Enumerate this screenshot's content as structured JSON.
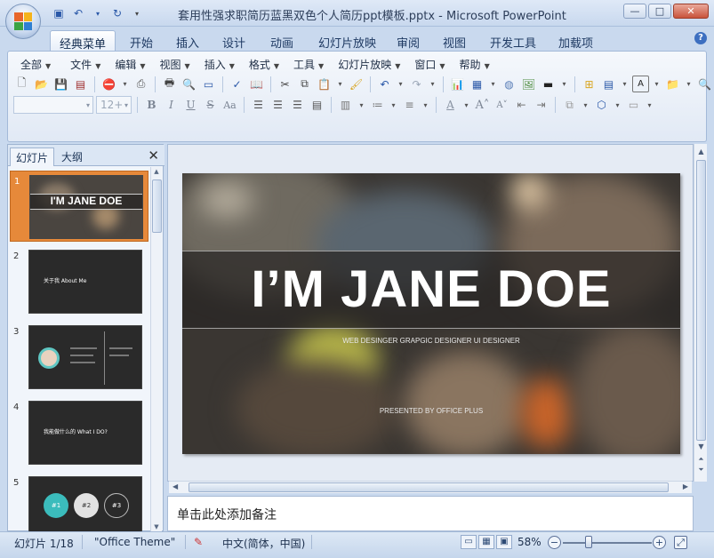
{
  "window": {
    "title": "套用性强求职简历蓝黑双色个人简历ppt模板.pptx - Microsoft PowerPoint",
    "buttons": {
      "minimize": "—",
      "maximize": "□",
      "close": "✕"
    }
  },
  "ribbon_tabs": [
    "经典菜单",
    "开始",
    "插入",
    "设计",
    "动画",
    "幻灯片放映",
    "审阅",
    "视图",
    "开发工具",
    "加载项"
  ],
  "classic_menu": [
    "全部",
    "文件",
    "编辑",
    "视图",
    "插入",
    "格式",
    "工具",
    "幻灯片放映",
    "窗口",
    "帮助"
  ],
  "font": {
    "name_value": "",
    "size_value": "12+"
  },
  "left_panel": {
    "tabs": [
      "幻灯片",
      "大纲"
    ],
    "close": "✕",
    "slides": [
      {
        "num": "1",
        "title": "I'M JANE DOE"
      },
      {
        "num": "2",
        "title": "关于我 About Me"
      },
      {
        "num": "3",
        "title": ""
      },
      {
        "num": "4",
        "title": "我能做什么的 What I DO?"
      },
      {
        "num": "5",
        "badges": [
          "#1",
          "#2",
          "#3"
        ]
      }
    ]
  },
  "slide": {
    "title": "I’M JANE DOE",
    "subtitle": "WEB DESINGER   GRAPGIC DESIGNER   UI DESIGNER",
    "presented": "PRESENTED BY OFFICE PLUS"
  },
  "notes": {
    "placeholder": "单击此处添加备注"
  },
  "status": {
    "slide_info": "幻灯片 1/18",
    "theme": "\"Office Theme\"",
    "language": "中文(简体，中国)",
    "zoom": "58%",
    "zoom_level": 0.58
  },
  "colors": {
    "selected_thumb": "#e6893a",
    "ribbon_bg": "#e1e9f5",
    "accent_blue": "#2a58a8"
  }
}
